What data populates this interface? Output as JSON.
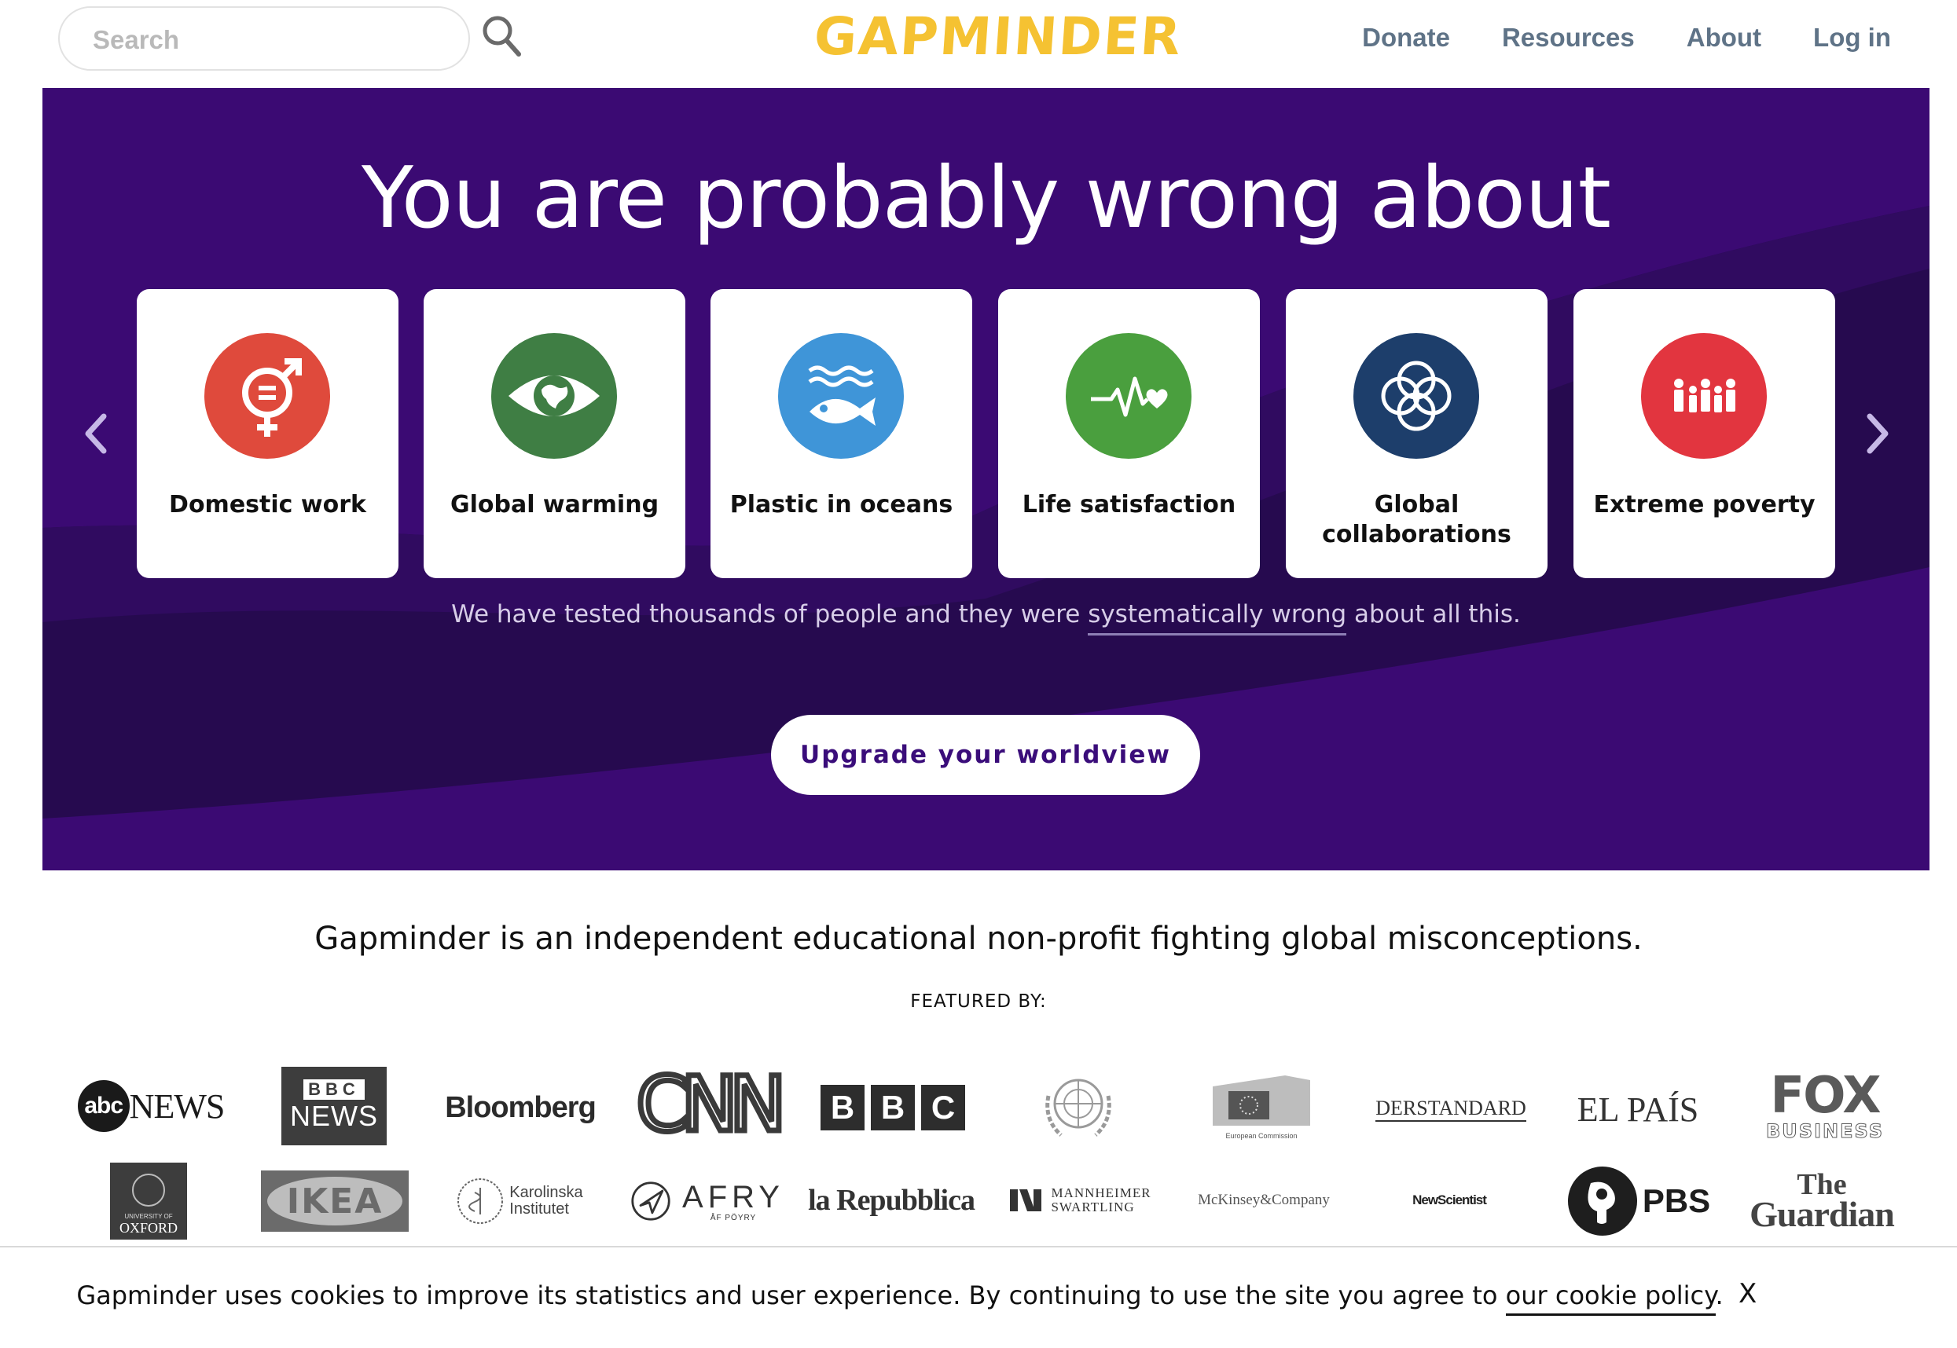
{
  "header": {
    "search_placeholder": "Search",
    "logo_text": "GAPMINDER",
    "nav": [
      "Donate",
      "Resources",
      "About",
      "Log in"
    ]
  },
  "hero": {
    "title": "You are probably wrong about",
    "cards": [
      {
        "label": "Domestic work",
        "icon": "gender-equality-icon",
        "color": "#df4a3c"
      },
      {
        "label": "Global warming",
        "icon": "climate-eye-icon",
        "color": "#3f7e44"
      },
      {
        "label": "Plastic in oceans",
        "icon": "fish-icon",
        "color": "#3f95d8"
      },
      {
        "label": "Life satisfaction",
        "icon": "heartbeat-icon",
        "color": "#4a9f3e"
      },
      {
        "label": "Global collaborations",
        "icon": "rings-icon",
        "color": "#1d3e6b"
      },
      {
        "label": "Extreme poverty",
        "icon": "family-icon",
        "color": "#e2353f"
      }
    ],
    "tagline_before": "We have tested thousands of people and they were ",
    "tagline_link": "systematically wrong",
    "tagline_after": " about all this.",
    "cta_label": "Upgrade your worldview"
  },
  "mission": "Gapminder is an independent educational non-profit fighting global misconceptions.",
  "featured_label": "FEATURED BY:",
  "logos_row1": [
    "abcNEWS",
    "BBC NEWS",
    "Bloomberg",
    "CNN",
    "BBC",
    "United Nations",
    "European Commission",
    "DERSTANDARD",
    "EL PAÍS",
    "FOX BUSINESS"
  ],
  "logos_row2": [
    "UNIVERSITY OF OXFORD",
    "IKEA",
    "Karolinska Institutet",
    "AFRY",
    "la Repubblica",
    "MANNHEIMER SWARTLING",
    "McKinsey&Company",
    "NewScientist",
    "PBS",
    "The Guardian"
  ],
  "logo_text": {
    "abc": "abc",
    "abc_news": "NEWS",
    "bbc_news_top": "BBC",
    "bbc_news_bottom": "NEWS",
    "bloomberg": "Bloomberg",
    "cnn": "CNN",
    "bbc": [
      "B",
      "B",
      "C"
    ],
    "european_commission": "European Commission",
    "derstandard": "DERSTANDARD",
    "elpais": "EL PAÍS",
    "fox": "FOX",
    "fox_business": "BUSINESS",
    "oxford_small": "UNIVERSITY OF",
    "oxford_big": "OXFORD",
    "ikea": "IKEA",
    "karolinska_1": "Karolinska",
    "karolinska_2": "Institutet",
    "afry": "AFRY",
    "afry_small": "ÅF PÖYRY",
    "repubblica": "la Repubblica",
    "mannheimer_1": "MANNHEIMER",
    "mannheimer_2": "SWARTLING",
    "mckinsey": "McKinsey&Company",
    "newscientist": "NewScientist",
    "pbs": "PBS",
    "guardian_1": "The",
    "guardian_2": "Guardian"
  },
  "cookie": {
    "text_before": "Gapminder uses cookies to improve its statistics and user experience. By continuing to use the site you agree to ",
    "link": "our cookie policy",
    "text_after": ".",
    "close": "X"
  },
  "colors": {
    "hero_dark": "#260a4f",
    "hero_purple": "#3b0a73",
    "logo_yellow": "#f5c232",
    "nav_gray": "#5f7387",
    "cta_text": "#3a0d7a"
  }
}
